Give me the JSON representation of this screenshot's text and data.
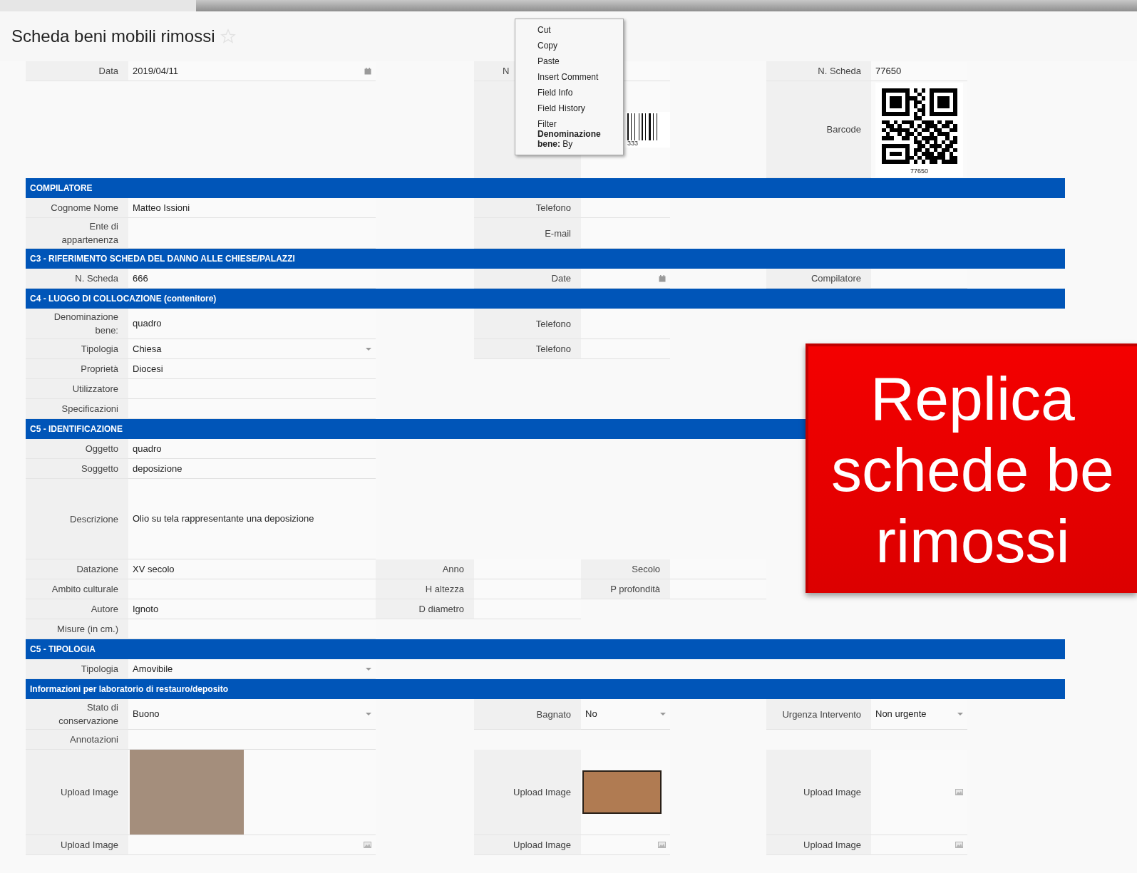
{
  "page": {
    "title": "Scheda beni mobili rimossi",
    "favorite": false
  },
  "context_menu": {
    "items": [
      "Cut",
      "Copy",
      "Paste",
      "Insert Comment",
      "Field Info",
      "Field History",
      "Filter **Denominazione bene:** By"
    ]
  },
  "banner": {
    "lines": [
      "Replica",
      "schede be",
      "rimossi"
    ]
  },
  "form": [
    {
      "kind": "row",
      "fields": [
        {
          "kind": "date",
          "label": "Data",
          "value": "2019/04/11"
        },
        {
          "kind": "text",
          "label": "N",
          "cut": true
        },
        {
          "kind": "text",
          "label": "N. Scheda",
          "value": "77650"
        }
      ]
    },
    {
      "kind": "row",
      "fields": [
        {
          "kind": "blank"
        },
        {
          "kind": "barcode",
          "value": "333"
        },
        {
          "kind": "qr",
          "label": "Barcode",
          "value": "77650"
        }
      ]
    },
    {
      "kind": "section",
      "title": "COMPILATORE"
    },
    {
      "kind": "row",
      "fields": [
        {
          "kind": "text",
          "label": "Cognome Nome",
          "value": "Matteo Issioni"
        },
        {
          "kind": "text",
          "label": "Telefono"
        }
      ]
    },
    {
      "kind": "row",
      "fields": [
        {
          "kind": "text",
          "label": "Ente di appartenenza"
        },
        {
          "kind": "text",
          "label": "E-mail"
        }
      ]
    },
    {
      "kind": "section",
      "title": "C3 - RIFERIMENTO SCHEDA DEL DANNO ALLE CHIESE/PALAZZI"
    },
    {
      "kind": "row",
      "fields": [
        {
          "kind": "text",
          "label": "N. Scheda",
          "value": "666"
        },
        {
          "kind": "date",
          "label": "Date"
        },
        {
          "kind": "text",
          "label": "Compilatore"
        }
      ]
    },
    {
      "kind": "section",
      "title": "C4 - LUOGO DI COLLOCAZIONE (contenitore)"
    },
    {
      "kind": "row",
      "fields": [
        {
          "kind": "text",
          "label": "Denominazione bene:",
          "value": "quadro"
        },
        {
          "kind": "text",
          "label": "Telefono"
        }
      ]
    },
    {
      "kind": "row",
      "fields": [
        {
          "kind": "select",
          "label": "Tipologia",
          "value": "Chiesa"
        },
        {
          "kind": "text",
          "label": "Telefono"
        }
      ]
    },
    {
      "kind": "row",
      "fields": [
        {
          "kind": "text",
          "label": "Proprietà",
          "value": "Diocesi"
        }
      ]
    },
    {
      "kind": "row",
      "fields": [
        {
          "kind": "text",
          "label": "Utilizzatore"
        }
      ]
    },
    {
      "kind": "row",
      "fields": [
        {
          "kind": "text",
          "label": "Specificazioni"
        }
      ]
    },
    {
      "kind": "section",
      "title": "C5 - IDENTIFICAZIONE"
    },
    {
      "kind": "row",
      "fields": [
        {
          "kind": "text",
          "label": "Oggetto",
          "value": "quadro"
        }
      ]
    },
    {
      "kind": "row",
      "fields": [
        {
          "kind": "text",
          "label": "Soggetto",
          "value": "deposizione"
        }
      ]
    },
    {
      "kind": "row",
      "fields": [
        {
          "kind": "textarea",
          "label": "Descrizione",
          "value": "Olio su tela rappresentante una deposizione"
        }
      ]
    },
    {
      "kind": "dense-row",
      "fields": [
        {
          "kind": "text",
          "label": "Datazione",
          "value": "XV secolo"
        },
        {
          "kind": "text",
          "label": "Anno"
        },
        {
          "kind": "text",
          "label": "Secolo"
        }
      ]
    },
    {
      "kind": "dense-row",
      "fields": [
        {
          "kind": "text",
          "label": "Ambito culturale"
        },
        {
          "kind": "text",
          "label": "H altezza"
        },
        {
          "kind": "text",
          "label": "P profondità"
        }
      ]
    },
    {
      "kind": "dense-row",
      "fields": [
        {
          "kind": "text",
          "label": "Autore",
          "value": "Ignoto"
        },
        {
          "kind": "text",
          "label": "D diametro"
        }
      ]
    },
    {
      "kind": "row",
      "fields": [
        {
          "kind": "text",
          "label": "Misure (in cm.)"
        }
      ]
    },
    {
      "kind": "section",
      "title": "C5 - TIPOLOGIA"
    },
    {
      "kind": "row",
      "fields": [
        {
          "kind": "select",
          "label": "Tipologia",
          "value": "Amovibile"
        }
      ]
    },
    {
      "kind": "section",
      "title": "Informazioni per laboratorio di restauro/deposito"
    },
    {
      "kind": "row",
      "fields": [
        {
          "kind": "select",
          "label": "Stato di conservazione",
          "value": "Buono"
        },
        {
          "kind": "select",
          "label": "Bagnato",
          "value": "No"
        },
        {
          "kind": "select",
          "label": "Urgenza Intervento",
          "value": "Non urgente"
        }
      ]
    },
    {
      "kind": "row",
      "fields": [
        {
          "kind": "text",
          "label": "Annotazioni"
        }
      ]
    },
    {
      "kind": "row",
      "fields": [
        {
          "kind": "photo-wide",
          "label": "Upload Image"
        },
        {
          "kind": "photo-small",
          "label": "Upload Image"
        },
        {
          "kind": "image",
          "label": "Upload Image"
        }
      ]
    },
    {
      "kind": "row",
      "fields": [
        {
          "kind": "image",
          "label": "Upload Image"
        },
        {
          "kind": "image",
          "label": "Upload Image"
        },
        {
          "kind": "image",
          "label": "Upload Image"
        }
      ]
    }
  ]
}
